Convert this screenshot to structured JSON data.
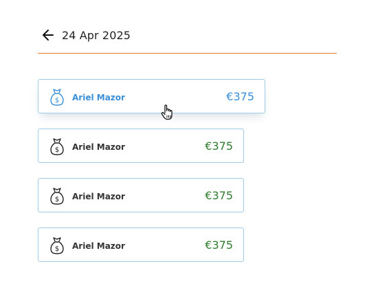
{
  "header": {
    "date": "24 Apr 2025"
  },
  "icons": {
    "back": "arrow-left-icon",
    "item": "money-bag-icon",
    "cursor": "hand-pointer-icon"
  },
  "colors": {
    "accent_line": "#e07b2c",
    "card_border": "#9fcbe6",
    "amount": "#2f7d2f",
    "hover": "#3a8fd8"
  },
  "items": [
    {
      "name": "Ariel Mazor",
      "amount": "€375",
      "state": "hover"
    },
    {
      "name": "Ariel Mazor",
      "amount": "€375"
    },
    {
      "name": "Ariel Mazor",
      "amount": "€375"
    },
    {
      "name": "Ariel Mazor",
      "amount": "€375"
    }
  ]
}
